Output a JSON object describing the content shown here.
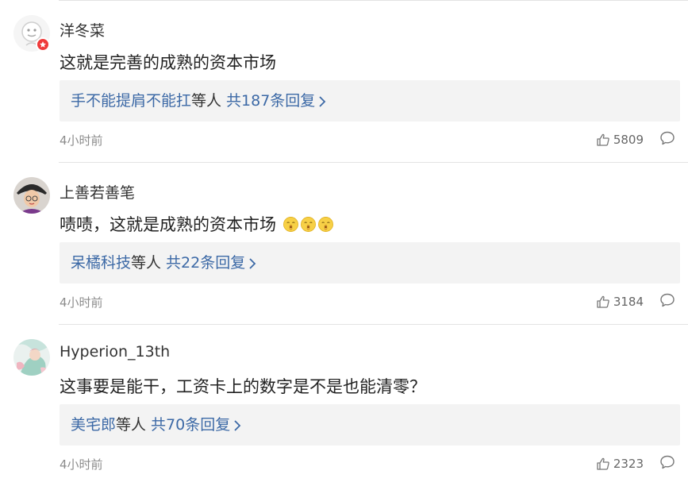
{
  "comments": [
    {
      "username": "洋冬菜",
      "text": "这就是完善的成熟的资本市场",
      "reply_names": "手不能提肩不能扛",
      "reply_etc": "等人",
      "reply_count": "共187条回复",
      "time": "4小时前",
      "likes": "5809",
      "avatar": "default-avatar-icon",
      "badge": "vip-badge-icon"
    },
    {
      "username": "上善若善笔",
      "text": "啧啧，这就是成熟的资本市场",
      "emojis": [
        "shush-emoji",
        "shush-emoji",
        "shush-emoji"
      ],
      "reply_names": "呆橘科技",
      "reply_etc": "等人",
      "reply_count": "共22条回复",
      "time": "4小时前",
      "likes": "3184",
      "avatar": "photo-avatar"
    },
    {
      "username": "Hyperion_13th",
      "text": "这事要是能干，工资卡上的数字是不是也能清零？",
      "reply_names": "美宅郎",
      "reply_etc": "等人",
      "reply_count": "共70条回复",
      "time": "4小时前",
      "likes": "2323",
      "avatar": "artwork-avatar"
    }
  ],
  "colors": {
    "link": "#3c69a6",
    "reply_bg": "#f3f3f3",
    "time": "#8c8c8c",
    "badge": "#ef3a3a"
  }
}
